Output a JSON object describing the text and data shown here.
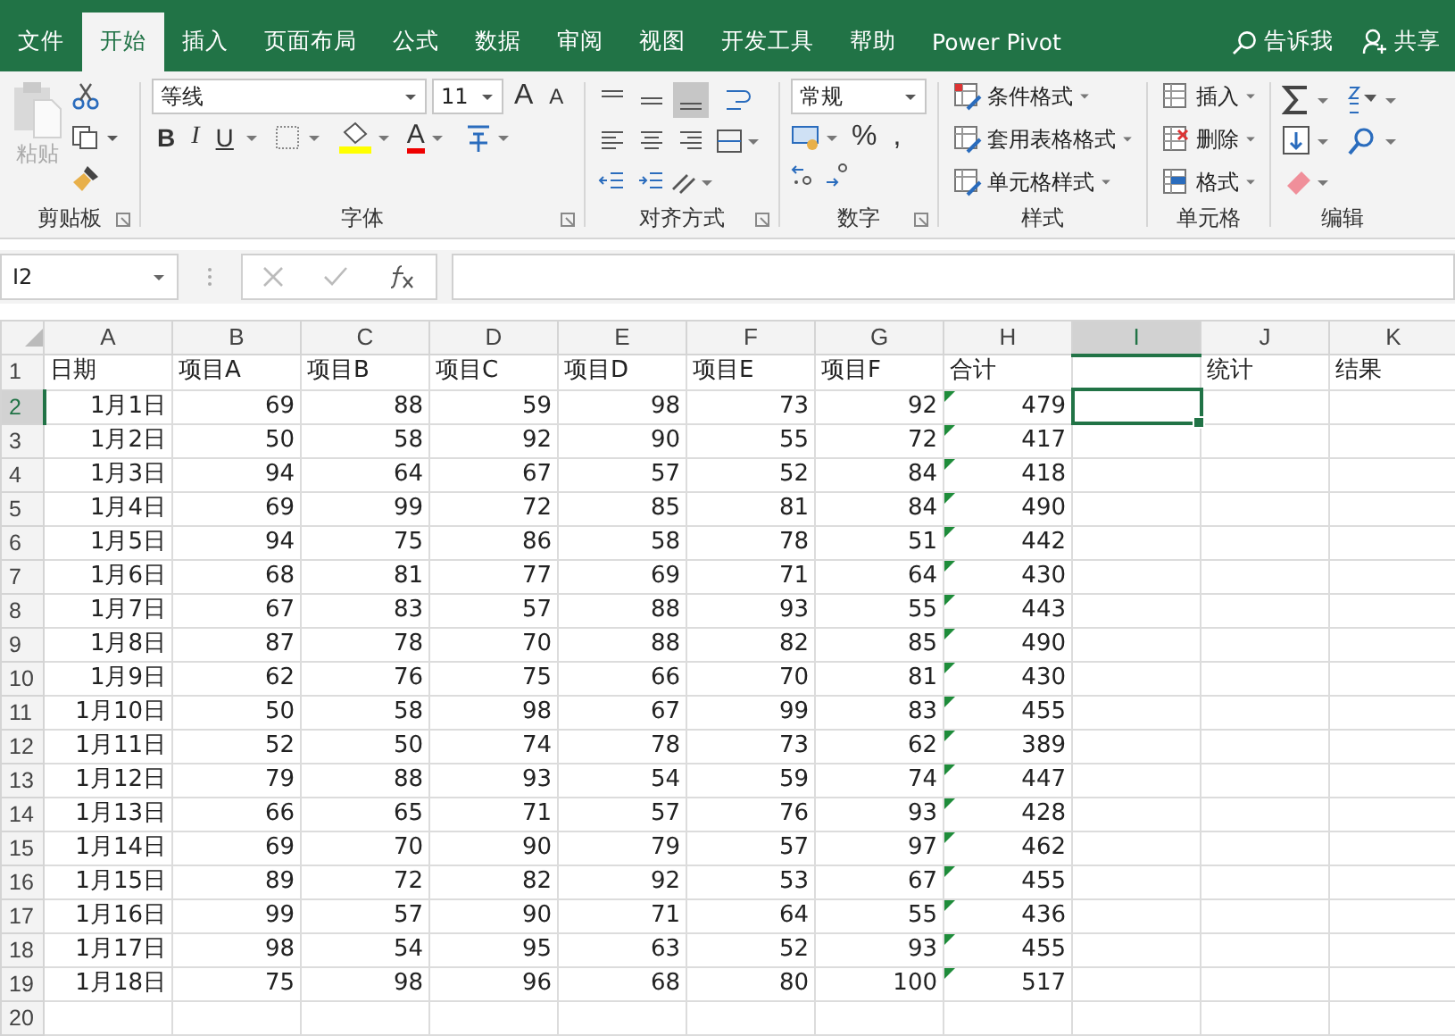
{
  "tabs": [
    {
      "label": "文件",
      "selected": false
    },
    {
      "label": "开始",
      "selected": true
    },
    {
      "label": "插入",
      "selected": false
    },
    {
      "label": "页面布局",
      "selected": false
    },
    {
      "label": "公式",
      "selected": false
    },
    {
      "label": "数据",
      "selected": false
    },
    {
      "label": "审阅",
      "selected": false
    },
    {
      "label": "视图",
      "selected": false
    },
    {
      "label": "开发工具",
      "selected": false
    },
    {
      "label": "帮助",
      "selected": false
    },
    {
      "label": "Power Pivot",
      "selected": false
    }
  ],
  "tell_me": "告诉我",
  "share": "共享",
  "ribbon": {
    "clipboard": {
      "label": "剪贴板",
      "paste": "粘贴",
      "paste_disabled": true
    },
    "font": {
      "label": "字体",
      "name": "等线",
      "size": "11",
      "grow": "A",
      "shrink": "A",
      "bold": "B",
      "italic": "I",
      "underline": "U",
      "color_letter": "A"
    },
    "alignment": {
      "label": "对齐方式"
    },
    "number": {
      "label": "数字",
      "format": "常规",
      "percent": "%",
      "comma": ","
    },
    "styles": {
      "label": "样式",
      "items": [
        "条件格式",
        "套用表格格式",
        "单元格样式"
      ]
    },
    "cells": {
      "label": "单元格",
      "items": [
        "插入",
        "删除",
        "格式"
      ]
    },
    "editing": {
      "label": "编辑"
    }
  },
  "name_box": "I2",
  "columns": [
    {
      "letter": "A",
      "selected": false
    },
    {
      "letter": "B",
      "selected": false
    },
    {
      "letter": "C",
      "selected": false
    },
    {
      "letter": "D",
      "selected": false
    },
    {
      "letter": "E",
      "selected": false
    },
    {
      "letter": "F",
      "selected": false
    },
    {
      "letter": "G",
      "selected": false
    },
    {
      "letter": "H",
      "selected": false
    },
    {
      "letter": "I",
      "selected": true
    },
    {
      "letter": "J",
      "selected": false
    },
    {
      "letter": "K",
      "selected": false
    }
  ],
  "rows": [
    {
      "num": "1",
      "kind": "header",
      "selected": false,
      "flag": false,
      "cells": {
        "A": "日期",
        "B": "项目A",
        "C": "项目B",
        "D": "项目C",
        "E": "项目D",
        "F": "项目E",
        "G": "项目F",
        "H": "合计",
        "J": "统计",
        "K": "结果"
      }
    },
    {
      "num": "2",
      "kind": "data",
      "selected": true,
      "flag": true,
      "cells": {
        "A": "1月1日",
        "B": "69",
        "C": "88",
        "D": "59",
        "E": "98",
        "F": "73",
        "G": "92",
        "H": "479"
      }
    },
    {
      "num": "3",
      "kind": "data",
      "selected": false,
      "flag": true,
      "cells": {
        "A": "1月2日",
        "B": "50",
        "C": "58",
        "D": "92",
        "E": "90",
        "F": "55",
        "G": "72",
        "H": "417"
      }
    },
    {
      "num": "4",
      "kind": "data",
      "selected": false,
      "flag": true,
      "cells": {
        "A": "1月3日",
        "B": "94",
        "C": "64",
        "D": "67",
        "E": "57",
        "F": "52",
        "G": "84",
        "H": "418"
      }
    },
    {
      "num": "5",
      "kind": "data",
      "selected": false,
      "flag": true,
      "cells": {
        "A": "1月4日",
        "B": "69",
        "C": "99",
        "D": "72",
        "E": "85",
        "F": "81",
        "G": "84",
        "H": "490"
      }
    },
    {
      "num": "6",
      "kind": "data",
      "selected": false,
      "flag": true,
      "cells": {
        "A": "1月5日",
        "B": "94",
        "C": "75",
        "D": "86",
        "E": "58",
        "F": "78",
        "G": "51",
        "H": "442"
      }
    },
    {
      "num": "7",
      "kind": "data",
      "selected": false,
      "flag": true,
      "cells": {
        "A": "1月6日",
        "B": "68",
        "C": "81",
        "D": "77",
        "E": "69",
        "F": "71",
        "G": "64",
        "H": "430"
      }
    },
    {
      "num": "8",
      "kind": "data",
      "selected": false,
      "flag": true,
      "cells": {
        "A": "1月7日",
        "B": "67",
        "C": "83",
        "D": "57",
        "E": "88",
        "F": "93",
        "G": "55",
        "H": "443"
      }
    },
    {
      "num": "9",
      "kind": "data",
      "selected": false,
      "flag": true,
      "cells": {
        "A": "1月8日",
        "B": "87",
        "C": "78",
        "D": "70",
        "E": "88",
        "F": "82",
        "G": "85",
        "H": "490"
      }
    },
    {
      "num": "10",
      "kind": "data",
      "selected": false,
      "flag": true,
      "cells": {
        "A": "1月9日",
        "B": "62",
        "C": "76",
        "D": "75",
        "E": "66",
        "F": "70",
        "G": "81",
        "H": "430"
      }
    },
    {
      "num": "11",
      "kind": "data",
      "selected": false,
      "flag": true,
      "cells": {
        "A": "1月10日",
        "B": "50",
        "C": "58",
        "D": "98",
        "E": "67",
        "F": "99",
        "G": "83",
        "H": "455"
      }
    },
    {
      "num": "12",
      "kind": "data",
      "selected": false,
      "flag": true,
      "cells": {
        "A": "1月11日",
        "B": "52",
        "C": "50",
        "D": "74",
        "E": "78",
        "F": "73",
        "G": "62",
        "H": "389"
      }
    },
    {
      "num": "13",
      "kind": "data",
      "selected": false,
      "flag": true,
      "cells": {
        "A": "1月12日",
        "B": "79",
        "C": "88",
        "D": "93",
        "E": "54",
        "F": "59",
        "G": "74",
        "H": "447"
      }
    },
    {
      "num": "14",
      "kind": "data",
      "selected": false,
      "flag": true,
      "cells": {
        "A": "1月13日",
        "B": "66",
        "C": "65",
        "D": "71",
        "E": "57",
        "F": "76",
        "G": "93",
        "H": "428"
      }
    },
    {
      "num": "15",
      "kind": "data",
      "selected": false,
      "flag": true,
      "cells": {
        "A": "1月14日",
        "B": "69",
        "C": "70",
        "D": "90",
        "E": "79",
        "F": "57",
        "G": "97",
        "H": "462"
      }
    },
    {
      "num": "16",
      "kind": "data",
      "selected": false,
      "flag": true,
      "cells": {
        "A": "1月15日",
        "B": "89",
        "C": "72",
        "D": "82",
        "E": "92",
        "F": "53",
        "G": "67",
        "H": "455"
      }
    },
    {
      "num": "17",
      "kind": "data",
      "selected": false,
      "flag": true,
      "cells": {
        "A": "1月16日",
        "B": "99",
        "C": "57",
        "D": "90",
        "E": "71",
        "F": "64",
        "G": "55",
        "H": "436"
      }
    },
    {
      "num": "18",
      "kind": "data",
      "selected": false,
      "flag": true,
      "cells": {
        "A": "1月17日",
        "B": "98",
        "C": "54",
        "D": "95",
        "E": "63",
        "F": "52",
        "G": "93",
        "H": "455"
      }
    },
    {
      "num": "19",
      "kind": "data",
      "selected": false,
      "flag": true,
      "cells": {
        "A": "1月18日",
        "B": "75",
        "C": "98",
        "D": "96",
        "E": "68",
        "F": "80",
        "G": "100",
        "H": "517"
      }
    },
    {
      "num": "20",
      "kind": "data",
      "selected": false,
      "flag": false
    }
  ]
}
